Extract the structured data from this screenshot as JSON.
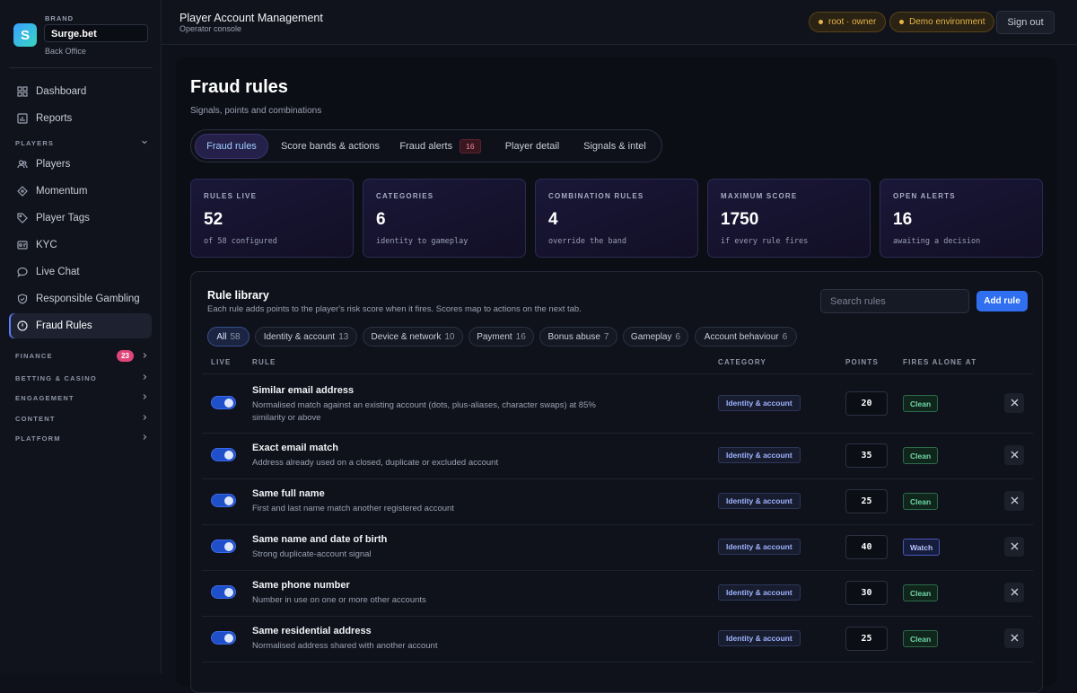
{
  "brand": {
    "caption": "BRAND",
    "name": "Surge.bet",
    "sub": "Back Office",
    "logo": "S"
  },
  "sidebar": {
    "top": [
      {
        "label": "Dashboard",
        "icon": "grid-icon"
      },
      {
        "label": "Reports",
        "icon": "chart-icon"
      }
    ],
    "players_section": "PLAYERS",
    "players": [
      {
        "label": "Players",
        "icon": "users-icon"
      },
      {
        "label": "Momentum",
        "icon": "diamond-icon"
      },
      {
        "label": "Player Tags",
        "icon": "tag-icon"
      },
      {
        "label": "KYC",
        "icon": "id-card-icon"
      },
      {
        "label": "Live Chat",
        "icon": "chat-icon"
      },
      {
        "label": "Responsible Gambling",
        "icon": "shield-icon"
      },
      {
        "label": "Fraud Rules",
        "icon": "alert-circle-icon",
        "active": true
      }
    ],
    "sections": [
      {
        "label": "FINANCE",
        "badge": "23"
      },
      {
        "label": "BETTING & CASINO"
      },
      {
        "label": "ENGAGEMENT"
      },
      {
        "label": "CONTENT"
      },
      {
        "label": "PLATFORM"
      }
    ]
  },
  "topbar": {
    "title": "Player Account Management",
    "subtitle": "Operator console",
    "user_tag": "root · owner",
    "env_tag": "Demo environment",
    "signout": "Sign out",
    "tag_color": "#e8b44a"
  },
  "page": {
    "title": "Fraud rules",
    "subtitle": "Signals, points and combinations"
  },
  "tabs": [
    {
      "label": "Fraud rules",
      "active": true
    },
    {
      "label": "Score bands & actions"
    },
    {
      "label": "Fraud alerts",
      "badge": "16"
    },
    {
      "label": "Player detail"
    },
    {
      "label": "Signals & intel"
    }
  ],
  "stats": [
    {
      "label": "RULES LIVE",
      "value": "52",
      "sub": "of 58 configured"
    },
    {
      "label": "CATEGORIES",
      "value": "6",
      "sub": "identity to gameplay"
    },
    {
      "label": "COMBINATION RULES",
      "value": "4",
      "sub": "override the band"
    },
    {
      "label": "MAXIMUM SCORE",
      "value": "1750",
      "sub": "if every rule fires"
    },
    {
      "label": "OPEN ALERTS",
      "value": "16",
      "sub": "awaiting a decision"
    }
  ],
  "library": {
    "title": "Rule library",
    "subtitle": "Each rule adds points to the player's risk score when it fires. Scores map to actions on the next tab.",
    "search_placeholder": "Search rules",
    "add_label": "Add rule",
    "filters": [
      {
        "label": "All",
        "count": "58",
        "active": true
      },
      {
        "label": "Identity & account",
        "count": "13"
      },
      {
        "label": "Device & network",
        "count": "10"
      },
      {
        "label": "Payment",
        "count": "16"
      },
      {
        "label": "Bonus abuse",
        "count": "7"
      },
      {
        "label": "Gameplay",
        "count": "6"
      },
      {
        "label": "Account behaviour",
        "count": "6"
      }
    ],
    "columns": {
      "live": "LIVE",
      "rule": "RULE",
      "category": "CATEGORY",
      "points": "POINTS",
      "fires": "FIRES ALONE AT"
    },
    "rules": [
      {
        "name": "Similar email address",
        "desc": "Normalised match against an existing account (dots, plus-aliases, character swaps) at 85% similarity or above",
        "category": "Identity & account",
        "points": "20",
        "fires": "Clean",
        "live": true
      },
      {
        "name": "Exact email match",
        "desc": "Address already used on a closed, duplicate or excluded account",
        "category": "Identity & account",
        "points": "35",
        "fires": "Clean",
        "live": true
      },
      {
        "name": "Same full name",
        "desc": "First and last name match another registered account",
        "category": "Identity & account",
        "points": "25",
        "fires": "Clean",
        "live": true
      },
      {
        "name": "Same name and date of birth",
        "desc": "Strong duplicate-account signal",
        "category": "Identity & account",
        "points": "40",
        "fires": "Watch",
        "live": true
      },
      {
        "name": "Same phone number",
        "desc": "Number in use on one or more other accounts",
        "category": "Identity & account",
        "points": "30",
        "fires": "Clean",
        "live": true
      },
      {
        "name": "Same residential address",
        "desc": "Normalised address shared with another account",
        "category": "Identity & account",
        "points": "25",
        "fires": "Clean",
        "live": true
      }
    ]
  }
}
